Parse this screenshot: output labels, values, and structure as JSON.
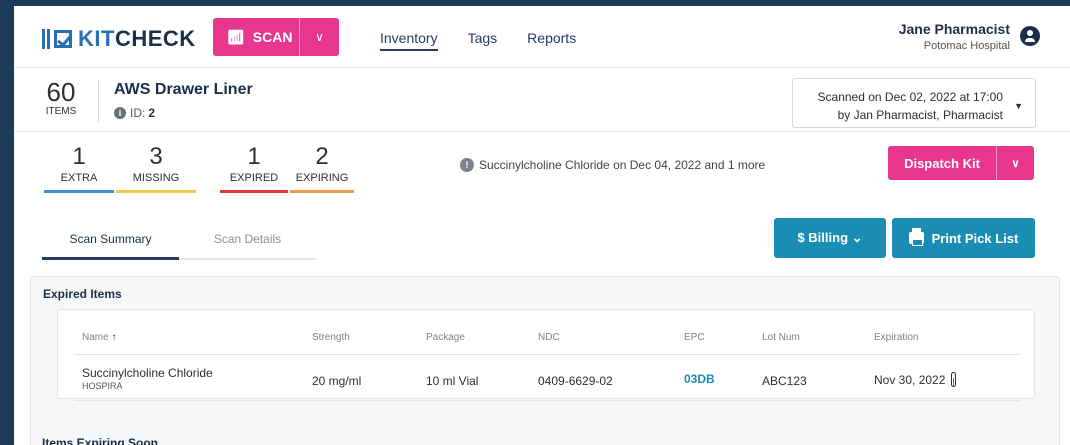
{
  "nav": {
    "logo_kit": "KIT",
    "logo_check": "CHECK",
    "scan_label": "SCAN",
    "links": [
      "Inventory",
      "Tags",
      "Reports"
    ],
    "user_name": "Jane Pharmacist",
    "user_hospital": "Potomac Hospital"
  },
  "kit": {
    "item_count": "60",
    "items_label": "ITEMS",
    "name": "AWS Drawer Liner",
    "id_label": "ID:",
    "id_value": "2",
    "scanned_line1": "Scanned on Dec 02, 2022 at 17:00",
    "scanned_line2": "by Jan Pharmacist, Pharmacist"
  },
  "stats": [
    {
      "value": "1",
      "label": "EXTRA",
      "color": "#3f8fd8"
    },
    {
      "value": "3",
      "label": "MISSING",
      "color": "#f2c94c"
    },
    {
      "value": "1",
      "label": "EXPIRED",
      "color": "#e53935"
    },
    {
      "value": "2",
      "label": "EXPIRING",
      "color": "#f2994a"
    }
  ],
  "alert_text": "Succinylcholine Chloride on Dec 04, 2022 and 1 more",
  "dispatch_label": "Dispatch Kit",
  "tabs": [
    "Scan Summary",
    "Scan Details"
  ],
  "billing_label": "$ Billing ⌄",
  "print_label": "Print Pick List",
  "expired": {
    "title": "Expired Items",
    "headers": [
      "Name",
      "Strength",
      "Package",
      "NDC",
      "EPC",
      "Lot Num",
      "Expiration"
    ],
    "rows": [
      {
        "name": "Succinylcholine Chloride",
        "manufacturer": "HOSPIRA",
        "strength": "20 mg/ml",
        "package": "10 ml Vial",
        "ndc": "0409-6629-02",
        "epc": "03DB",
        "lot": "ABC123",
        "expiration": "Nov 30, 2022"
      }
    ]
  },
  "expiring_title": "Items Expiring Soon"
}
